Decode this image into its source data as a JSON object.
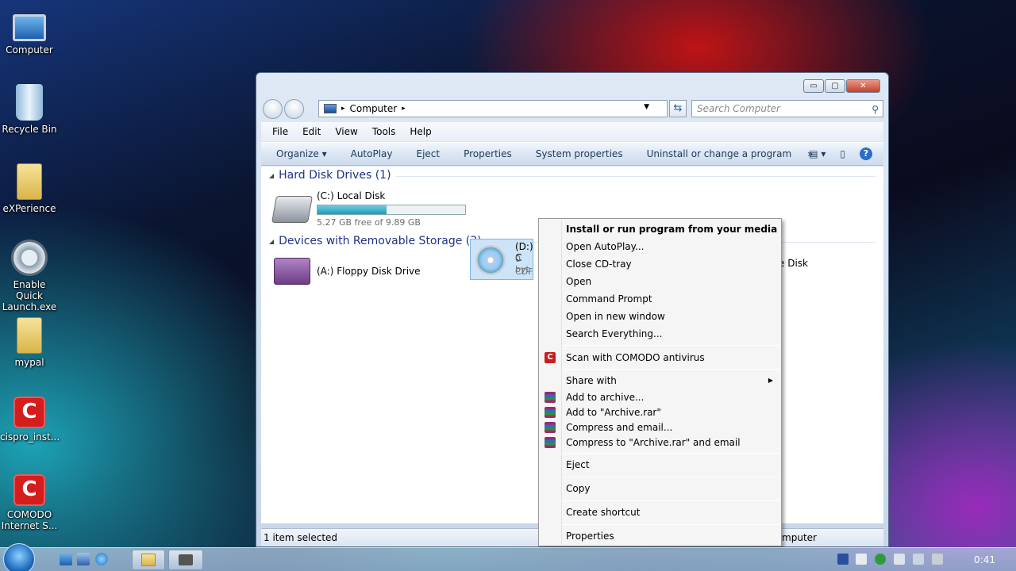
{
  "desktop": {
    "icons": [
      {
        "label": "Computer"
      },
      {
        "label": "Recycle Bin"
      },
      {
        "label": "eXPerience"
      },
      {
        "label": "Enable Quick Launch.exe"
      },
      {
        "label": "mypal"
      },
      {
        "label": "cispro_inst..."
      },
      {
        "label": "COMODO Internet S..."
      }
    ]
  },
  "window": {
    "controls": {
      "minimize": "▭",
      "maximize": "▢",
      "close": "✕"
    },
    "address": {
      "path": "Computer",
      "separator": "▸"
    },
    "search": {
      "placeholder": "Search Computer"
    },
    "menu": [
      "File",
      "Edit",
      "View",
      "Tools",
      "Help"
    ],
    "commands": [
      "Organize ▾",
      "AutoPlay",
      "Eject",
      "Properties",
      "System properties",
      "Uninstall or change a program",
      "»"
    ],
    "groups": {
      "hdd": {
        "title": "Hard Disk Drives (1)"
      },
      "removable": {
        "title": "Devices with Removable Storage (3)"
      }
    },
    "drives": {
      "c": {
        "name": "(C:) Local Disk",
        "free_text": "5.27 GB free of 9.89 GB",
        "used_fraction": 0.47
      },
      "a": {
        "name": "(A:) Floppy Disk Drive"
      },
      "d": {
        "name": "(D:) C",
        "line2": "0 byt",
        "line3": "CDF"
      },
      "partial_right": {
        "name": "e Disk"
      }
    },
    "status": {
      "left": "1 item selected",
      "right": "omputer"
    }
  },
  "context_menu": {
    "items": [
      {
        "label": "Install or run program from your media",
        "bold": true
      },
      {
        "label": "Open AutoPlay..."
      },
      {
        "label": "Close CD-tray"
      },
      {
        "label": "Open"
      },
      {
        "label": "Command Prompt"
      },
      {
        "label": "Open in new window"
      },
      {
        "label": "Search Everything..."
      },
      {
        "label": "Scan with COMODO antivirus",
        "icon": "comodo-icon"
      },
      {
        "label": "Share with",
        "submenu": true
      },
      {
        "label": "Add to archive...",
        "icon": "winrar-icon"
      },
      {
        "label": "Add to \"Archive.rar\"",
        "icon": "winrar-icon"
      },
      {
        "label": "Compress and email...",
        "icon": "winrar-icon"
      },
      {
        "label": "Compress to \"Archive.rar\" and email",
        "icon": "winrar-icon"
      },
      {
        "label": "Eject"
      },
      {
        "label": "Copy"
      },
      {
        "label": "Create shortcut"
      },
      {
        "label": "Properties"
      }
    ]
  },
  "taskbar": {
    "clock": "0:41"
  },
  "colors": {
    "accent": "#1e3287",
    "capacity_fill": "#2796b8",
    "comodo_red": "#c81e1e"
  }
}
